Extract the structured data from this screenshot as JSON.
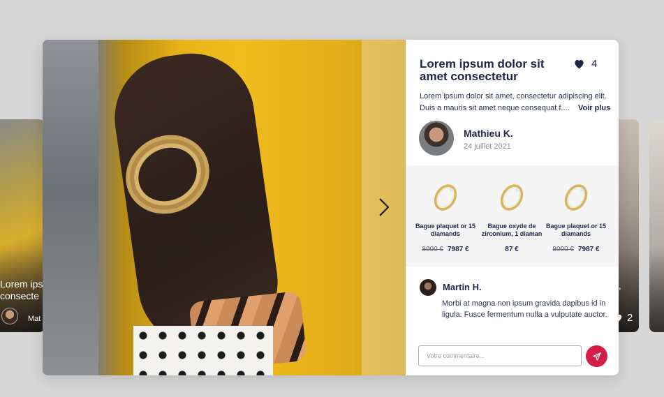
{
  "background_cards": {
    "left": {
      "title_line1": "Lorem ips",
      "title_line2": "consecte",
      "author": "Mat"
    },
    "right": {
      "title_fragment": "t,",
      "likes": "2"
    }
  },
  "modal": {
    "title": "Lorem ipsum dolor sit amet consectetur",
    "likes": {
      "icon": "heart-icon",
      "count": "4"
    },
    "description": {
      "line1": "Lorem ipsum dolor sit amet, consectetur adipiscing elit.",
      "line2": "Duis a mauris sit amet neque consequat f....",
      "see_more": "Voir plus"
    },
    "author": {
      "name": "Mathieu K.",
      "date": "24 juillet 2021"
    },
    "next_icon": "chevron-right-icon",
    "products": [
      {
        "name": "Bague plaquet or 15 diamands",
        "old_price": "8000 €",
        "price": "7987 €"
      },
      {
        "name": "Bague oxyde de zirconium, 1 diaman",
        "old_price": "",
        "price": "87 €"
      },
      {
        "name": "Bague plaquet or 15 diamands",
        "old_price": "8000 €",
        "price": "7987 €"
      }
    ],
    "comment": {
      "author": "Martin H.",
      "text": "Morbi at magna non ipsum gravida dapibus id in ligula. Fusce fermentum nulla a vulputate auctor."
    },
    "comment_input": {
      "placeholder": "Votre commentaire...",
      "value": ""
    },
    "send_icon": "paper-plane-icon"
  },
  "colors": {
    "navy": "#1b2748",
    "accent": "#d31f47",
    "backdrop": "#d6d6d6"
  }
}
